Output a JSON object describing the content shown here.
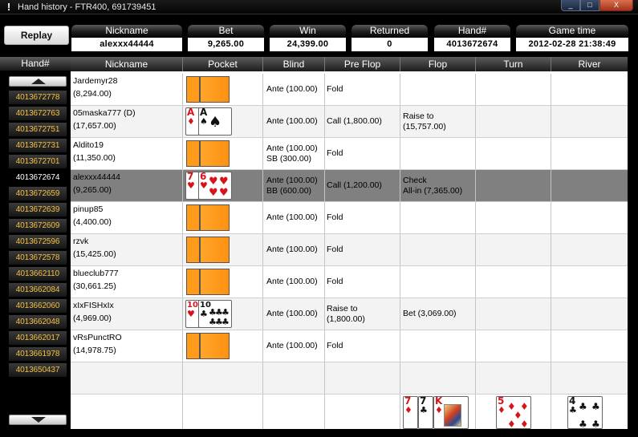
{
  "window": {
    "title": "Hand history - FTR400, 691739451",
    "warn_icon": "!",
    "controls": [
      "_",
      "□",
      "X"
    ]
  },
  "replay_label": "Replay",
  "summary": {
    "nickname": {
      "label": "Nickname",
      "value": "alexxx44444"
    },
    "bet": {
      "label": "Bet",
      "value": "9,265.00"
    },
    "win": {
      "label": "Win",
      "value": "24,399.00"
    },
    "returned": {
      "label": "Returned",
      "value": "0"
    },
    "hand": {
      "label": "Hand#",
      "value": "4013672674"
    },
    "game_time": {
      "label": "Game time",
      "value": "2012-02-28 21:38:49"
    }
  },
  "hand_list": {
    "header": "Hand#",
    "items": [
      "4013672778",
      "4013672763",
      "4013672751",
      "4013672731",
      "4013672701",
      "4013672674",
      "4013672659",
      "4013672639",
      "4013672609",
      "4013672596",
      "4013672578",
      "4013662110",
      "4013662084",
      "4013662060",
      "4013662048",
      "4013662017",
      "4013661978",
      "4013650437"
    ],
    "selected_index": 5
  },
  "table": {
    "columns": [
      "Nickname",
      "Pocket",
      "Blind",
      "Pre Flop",
      "Flop",
      "Turn",
      "River"
    ],
    "rows": [
      {
        "nick": "Jardemyr28",
        "stack": "(8,294.00)",
        "pocket": "hidden",
        "blind1": "Ante (100.00)",
        "blind2": "",
        "pre1": "Fold",
        "pre2": "",
        "flop1": "",
        "flop2": ""
      },
      {
        "nick": "05maska777 (D)",
        "stack": "(17,657.00)",
        "pocket": "A♦ A♠",
        "blind1": "Ante (100.00)",
        "blind2": "",
        "pre1": "Call (1,800.00)",
        "pre2": "",
        "flop1": "Raise to",
        "flop2": "(15,757.00)"
      },
      {
        "nick": "Aldito19",
        "stack": "(11,350.00)",
        "pocket": "hidden",
        "blind1": "Ante (100.00)",
        "blind2": "SB (300.00)",
        "pre1": "Fold",
        "pre2": "",
        "flop1": "",
        "flop2": ""
      },
      {
        "nick": "alexxx44444",
        "stack": "(9,265.00)",
        "pocket": "7♥ 6♥",
        "blind1": "Ante (100.00)",
        "blind2": "BB (600.00)",
        "pre1": "Call (1,200.00)",
        "pre2": "",
        "flop1": "Check",
        "flop2": "All-in (7,365.00)"
      },
      {
        "nick": "pinup85",
        "stack": "(4,400.00)",
        "pocket": "hidden",
        "blind1": "Ante (100.00)",
        "blind2": "",
        "pre1": "Fold",
        "pre2": "",
        "flop1": "",
        "flop2": ""
      },
      {
        "nick": "rzvk",
        "stack": "(15,425.00)",
        "pocket": "hidden",
        "blind1": "Ante (100.00)",
        "blind2": "",
        "pre1": "Fold",
        "pre2": "",
        "flop1": "",
        "flop2": ""
      },
      {
        "nick": "blueclub777",
        "stack": "(30,661.25)",
        "pocket": "hidden",
        "blind1": "Ante (100.00)",
        "blind2": "",
        "pre1": "Fold",
        "pre2": "",
        "flop1": "",
        "flop2": ""
      },
      {
        "nick": "xIxFISHxIx",
        "stack": "(4,969.00)",
        "pocket": "10♥ 10♣",
        "blind1": "Ante (100.00)",
        "blind2": "",
        "pre1": "Raise to",
        "pre2": "(1,800.00)",
        "flop1": "Bet (3,069.00)",
        "flop2": ""
      },
      {
        "nick": "vRsPunctRO",
        "stack": "(14,978.75)",
        "pocket": "hidden",
        "blind1": "Ante (100.00)",
        "blind2": "",
        "pre1": "Fold",
        "pre2": "",
        "flop1": "",
        "flop2": ""
      }
    ],
    "board": {
      "flop": [
        "7♦",
        "7♣",
        "K♦"
      ],
      "turn": [
        "5♦"
      ],
      "river": [
        "4♣"
      ]
    }
  },
  "cards": {
    "A": "A",
    "seven": "7",
    "six": "6",
    "ten": "10",
    "K": "K",
    "five": "5",
    "four": "4",
    "diamond": "♦",
    "spade": "♠",
    "heart": "♥",
    "club": "♣"
  }
}
